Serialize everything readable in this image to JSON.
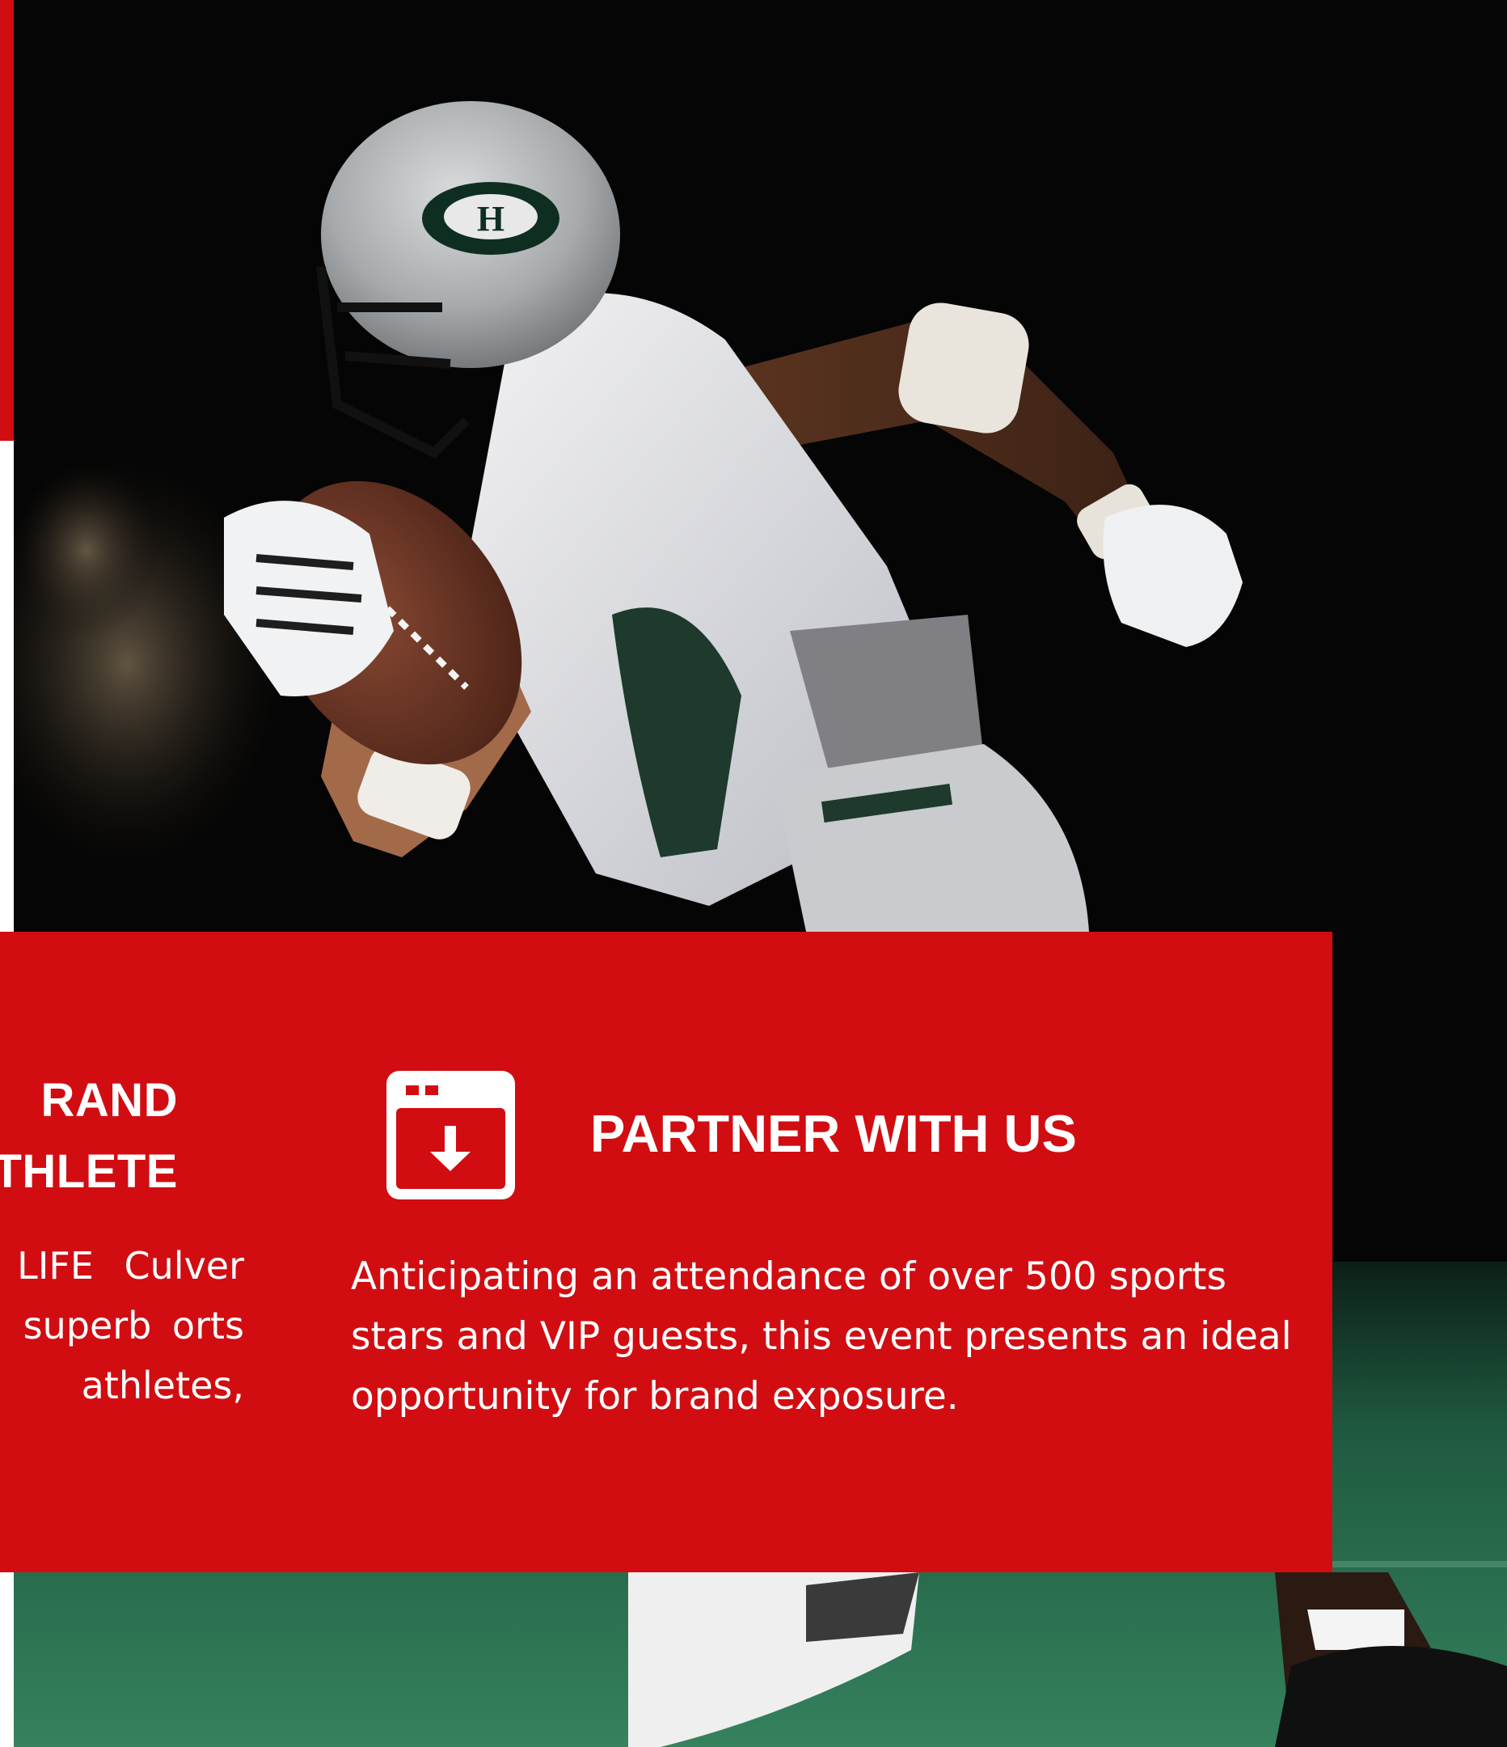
{
  "brand_section": {
    "title": "RAND\nTHLETE",
    "text": "ne LUX LIFE Culver City, r a superb orts athletes,"
  },
  "partner_section": {
    "icon": "calendar-download-icon",
    "title": "PARTNER WITH US",
    "text": "Anticipating an attendance of over 500 sports stars and VIP guests, this event presents an ideal opportunity for brand exposure."
  },
  "photo": {
    "subject": "football-player-running-image",
    "helmet_letter": "H"
  },
  "colors": {
    "accent_red": "#d10d12",
    "text_white": "#ffffff",
    "field_green": "#2f7a57",
    "night_black": "#050505"
  }
}
